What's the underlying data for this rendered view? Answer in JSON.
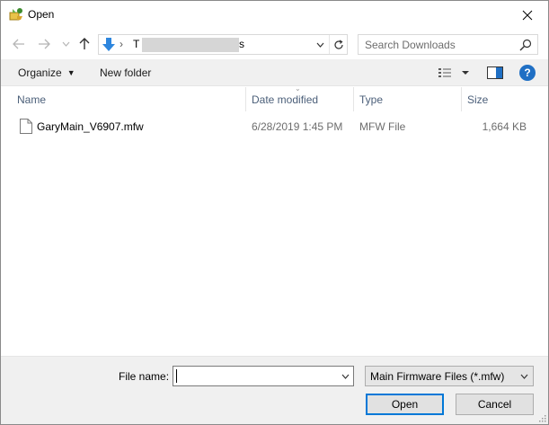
{
  "window": {
    "title": "Open"
  },
  "nav": {
    "address_start": "T",
    "address_end": "s",
    "chevron": "›",
    "search_placeholder": "Search Downloads"
  },
  "commands": {
    "organize": "Organize",
    "new_folder": "New folder",
    "help": "?"
  },
  "columns": {
    "name": "Name",
    "date": "Date modified",
    "type": "Type",
    "size": "Size"
  },
  "files": [
    {
      "name": "GaryMain_V6907.mfw",
      "date": "6/28/2019 1:45 PM",
      "type": "MFW File",
      "size": "1,664 KB"
    }
  ],
  "footer": {
    "file_name_label": "File name:",
    "file_name_value": "",
    "filter": "Main Firmware Files (*.mfw)",
    "open_label": "Open",
    "cancel_label": "Cancel"
  },
  "colors": {
    "accent": "#0078d7",
    "header_text": "#4c607a",
    "bar_bg": "#f0f0f0",
    "help": "#1f6fc4"
  }
}
